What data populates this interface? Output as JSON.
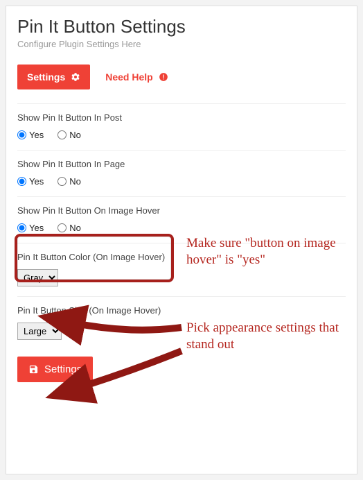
{
  "header": {
    "title": "Pin It Button Settings",
    "subtitle": "Configure Plugin Settings Here"
  },
  "tabs": {
    "settings": "Settings",
    "help": "Need Help"
  },
  "options": {
    "yes": "Yes",
    "no": "No"
  },
  "fields": {
    "in_post": {
      "label": "Show Pin It Button In Post",
      "value": "yes"
    },
    "in_page": {
      "label": "Show Pin It Button In Page",
      "value": "yes"
    },
    "on_hover": {
      "label": "Show Pin It Button On Image Hover",
      "value": "yes"
    },
    "color": {
      "label": "Pin It Button Color (On Image Hover)",
      "value": "Gray"
    },
    "size": {
      "label": "Pin It Button Size (On Image Hover)",
      "value": "Large"
    }
  },
  "save_label": "Settings",
  "annotations": {
    "hover_note": "Make sure \"button on image hover\" is \"yes\"",
    "appearance_note": "Pick appearance settings that stand out"
  }
}
